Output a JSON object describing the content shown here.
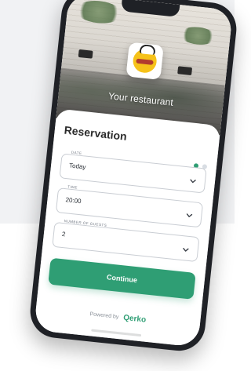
{
  "colors": {
    "accent": "#2f9e74",
    "background_top": "#f1f2f4",
    "phone_frame": "#1f2126"
  },
  "restaurant": {
    "name": "Your restaurant"
  },
  "reservation": {
    "title": "Reservation",
    "step_indicator": {
      "current": 1,
      "total": 2
    },
    "fields": [
      {
        "label": "DATE",
        "value": "Today",
        "icon": "chevron-down-icon"
      },
      {
        "label": "TIME",
        "value": "20:00",
        "icon": "chevron-down-icon"
      },
      {
        "label": "NUMBER OF GUESTS",
        "value": "2",
        "icon": "chevron-down-icon"
      }
    ],
    "continue_label": "Continue"
  },
  "footer": {
    "powered_by": "Powered by",
    "brand": "Qerko"
  }
}
